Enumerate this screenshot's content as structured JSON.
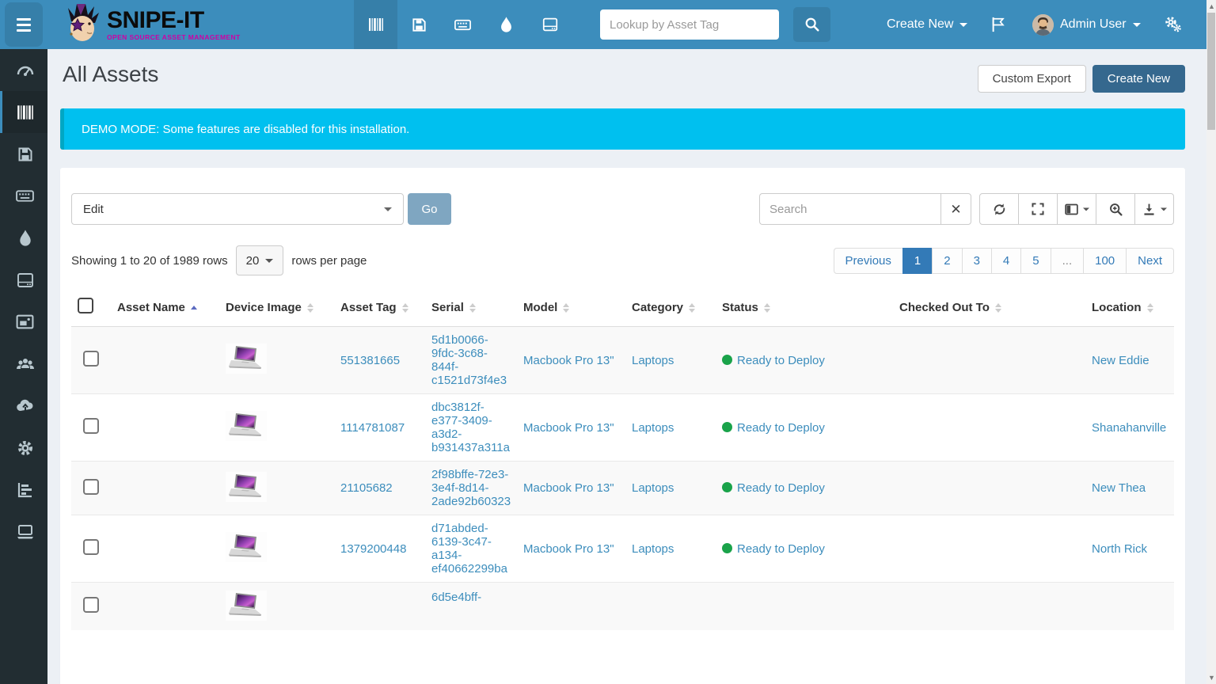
{
  "colors": {
    "navbar_blue": "#3c8dbc",
    "navbar_dark": "#367fa9",
    "sidebar_bg": "#222d32",
    "sidebar_active_bg": "#1e282c",
    "banner_cyan": "#00c0ef",
    "banner_edge": "#00a7c4",
    "primary_btn": "#35688e",
    "go_btn": "#7fa6c1",
    "link": "#3c8dbc",
    "status_green": "#1aa34a",
    "pagination_active": "#337ab7",
    "sort_active": "#5c6bc0"
  },
  "navbar": {
    "brand_title": "SNIPE-IT",
    "brand_subtitle": "OPEN SOURCE ASSET MANAGEMENT",
    "quick_nav_active": "assets",
    "lookup_placeholder": "Lookup by Asset Tag",
    "create_new_label": "Create New",
    "user_name": "Admin User"
  },
  "sidebar": {
    "active_item": "assets",
    "items": [
      "dashboard",
      "assets",
      "licenses",
      "accessories",
      "consumables",
      "components",
      "kits",
      "people",
      "import",
      "settings",
      "reports",
      "requestable"
    ]
  },
  "page": {
    "title": "All Assets",
    "custom_export_label": "Custom Export",
    "create_new_label": "Create New",
    "demo_banner": "DEMO MODE: Some features are disabled for this installation."
  },
  "toolbar": {
    "bulk_action_selected": "Edit",
    "go_label": "Go",
    "search_placeholder": "Search"
  },
  "table_info": {
    "showing_text": "Showing 1 to 20 of 1989 rows",
    "page_size": "20",
    "rows_per_page_label": "rows per page"
  },
  "pagination": {
    "previous_label": "Previous",
    "pages": [
      "1",
      "2",
      "3",
      "4",
      "5",
      "...",
      "100"
    ],
    "active_page": "1",
    "next_label": "Next"
  },
  "table": {
    "columns": [
      {
        "label": "Asset Name",
        "sort": "asc"
      },
      {
        "label": "Device Image",
        "sort": "both"
      },
      {
        "label": "Asset Tag",
        "sort": "both"
      },
      {
        "label": "Serial",
        "sort": "both"
      },
      {
        "label": "Model",
        "sort": "both"
      },
      {
        "label": "Category",
        "sort": "both"
      },
      {
        "label": "Status",
        "sort": "both"
      },
      {
        "label": "Checked Out To",
        "sort": "both"
      },
      {
        "label": "Location",
        "sort": "both"
      }
    ],
    "rows": [
      {
        "asset_name": "",
        "has_image": true,
        "asset_tag": "551381665",
        "serial": "5d1b0066-9fdc-3c68-844f-c1521d73f4e3",
        "model": "Macbook Pro 13\"",
        "category": "Laptops",
        "status": "Ready to Deploy",
        "checked_out_to": "",
        "location": "New Eddie"
      },
      {
        "asset_name": "",
        "has_image": true,
        "asset_tag": "1114781087",
        "serial": "dbc3812f-e377-3409-a3d2-b931437a311a",
        "model": "Macbook Pro 13\"",
        "category": "Laptops",
        "status": "Ready to Deploy",
        "checked_out_to": "",
        "location": "Shanahanville"
      },
      {
        "asset_name": "",
        "has_image": true,
        "asset_tag": "21105682",
        "serial": "2f98bffe-72e3-3e4f-8d14-2ade92b60323",
        "model": "Macbook Pro 13\"",
        "category": "Laptops",
        "status": "Ready to Deploy",
        "checked_out_to": "",
        "location": "New Thea"
      },
      {
        "asset_name": "",
        "has_image": true,
        "asset_tag": "1379200448",
        "serial": "d71abded-6139-3c47-a134-ef40662299ba",
        "model": "Macbook Pro 13\"",
        "category": "Laptops",
        "status": "Ready to Deploy",
        "checked_out_to": "",
        "location": "North Rick"
      },
      {
        "asset_name": "",
        "has_image": true,
        "asset_tag": "",
        "serial": "6d5e4bff-",
        "model": "",
        "category": "",
        "status": "",
        "checked_out_to": "",
        "location": "",
        "partial": true
      }
    ]
  }
}
